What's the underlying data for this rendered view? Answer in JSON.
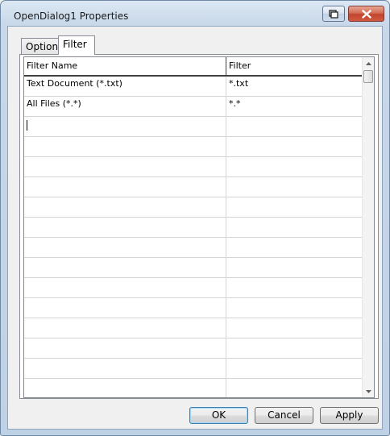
{
  "window": {
    "title": "OpenDialog1 Properties"
  },
  "tabs": [
    {
      "label": "Options",
      "selected": false
    },
    {
      "label": "Filter",
      "selected": true
    }
  ],
  "grid": {
    "columns": [
      "Filter Name",
      "Filter"
    ],
    "rows": [
      {
        "name": "Text Document (*.txt)",
        "filter": "*.txt"
      },
      {
        "name": "All Files (*.*)",
        "filter": "*.*"
      }
    ]
  },
  "buttons": {
    "ok": "OK",
    "cancel": "Cancel",
    "apply": "Apply"
  },
  "icons": {
    "help": "context-help-icon",
    "close": "close-icon",
    "scroll_up": "arrow-up-icon",
    "scroll_down": "arrow-down-icon"
  },
  "colors": {
    "focus_border": "#3c7fb1",
    "close_button": "#c2452d",
    "window_frame": "#bfd1e4"
  }
}
